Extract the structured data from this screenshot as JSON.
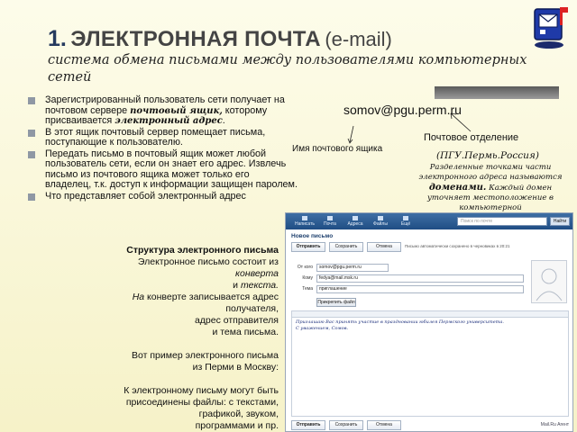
{
  "title": {
    "number": "1.",
    "main": "ЭЛЕКТРОННАЯ ПОЧТА",
    "latin": "(e-mail)",
    "subtitle": "система обмена письмами между пользователями компьютерных сетей"
  },
  "bullets": [
    {
      "pre": "Зарегистрированный пользователь сети получает на почтовом сервере ",
      "em1": "почтовый ящик,",
      "mid": " которому присваивается ",
      "em2": "электронный адрес",
      "post": "."
    },
    {
      "text": "В этот ящик почтовый сервер помещает письма, поступающие к пользователю."
    },
    {
      "text": "Передать письмо в почтовый ящик может любой пользователь сети, если он знает его адрес. Извлечь письмо из почтового ящика может только его владелец, т.к. доступ к информации защищен паролем."
    },
    {
      "text": "Что представляет собой электронный адрес"
    }
  ],
  "annotation": {
    "email": "somov@pgu.perm.ru",
    "mailbox_label": "Имя почтового ящика",
    "post_office": "Почтовое отделение",
    "domain_example": "(ПГУ.Пермь.Россия)",
    "domain_desc_pre": "Разделенные точками части электронного адреса называются ",
    "domain_desc_em": "доменами.",
    "domain_desc_post": " Каждый домен уточняет местоположение в компьютерной"
  },
  "structure": {
    "heading": "Структура электронного письма",
    "line1": "Электронное письмо состоит из",
    "line2": "конверта",
    "line3_pre": "и ",
    "line3_em": "текста.",
    "line4_em": "На",
    "line4_rest": " конверте записывается адрес",
    "line5": "получателя,",
    "line6": "адрес отправителя",
    "line7": "и тема письма.",
    "line8": "Вот пример электронного письма",
    "line9": "из Перми в Москву:",
    "line10": "К электронному письму могут быть",
    "line11": "присоединены файлы: с текстами,",
    "line12": "графикой, звуком,",
    "line13": "программами и пр."
  },
  "client": {
    "tabs": [
      "Написать",
      "Почта",
      "Адреса",
      "Файлы",
      "Ещё"
    ],
    "search_placeholder": "Поиск по почте",
    "search_button": "Найти",
    "heading": "Новое письмо",
    "toolbar": [
      "Отправить",
      "Сохранить",
      "Отмена"
    ],
    "note": "Письмо автоматически сохранено в черновиках в 20:21",
    "from_label": "От кого",
    "from_value": "somov@pgu.perm.ru",
    "to_label": "Кому",
    "to_value": "fedya@mail.msk.ru",
    "subject_label": "Тема",
    "subject_value": "приглашение",
    "attach_button": "Прикрепить файл",
    "body_line1": "Приглашаю Вас принять участие в праздновании юбилея Пермского университета.",
    "body_line2": "С уважением, Сомов.",
    "bottom_buttons": [
      "Отправить",
      "Сохранить",
      "Отмена"
    ],
    "footer": "Mail.Ru Агент"
  },
  "colors": {
    "title_blue": "#253a5e",
    "client_bar": "#2b5a92"
  }
}
